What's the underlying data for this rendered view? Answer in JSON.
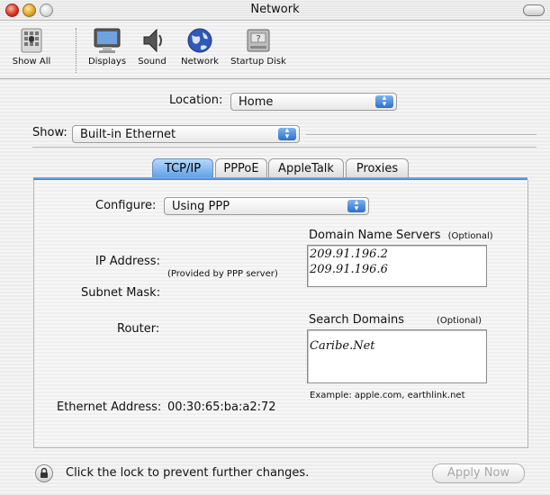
{
  "window": {
    "title": "Network"
  },
  "toolbar": {
    "items": [
      {
        "label": "Show All",
        "icon": "show-all-icon"
      },
      {
        "label": "Displays",
        "icon": "displays-icon"
      },
      {
        "label": "Sound",
        "icon": "sound-icon"
      },
      {
        "label": "Network",
        "icon": "network-icon"
      },
      {
        "label": "Startup Disk",
        "icon": "startup-disk-icon"
      }
    ]
  },
  "location": {
    "label": "Location:",
    "value": "Home"
  },
  "show": {
    "label": "Show:",
    "value": "Built-in Ethernet"
  },
  "tabs": [
    "TCP/IP",
    "PPPoE",
    "AppleTalk",
    "Proxies"
  ],
  "tcpip": {
    "configure_label": "Configure:",
    "configure_value": "Using PPP",
    "ip_address_label": "IP Address:",
    "provided_note": "(Provided by PPP server)",
    "subnet_mask_label": "Subnet Mask:",
    "router_label": "Router:",
    "dns_label": "Domain Name Servers",
    "dns_optional": "(Optional)",
    "dns_servers": [
      "209.91.196.2",
      "209.91.196.6"
    ],
    "search_label": "Search Domains",
    "search_optional": "(Optional)",
    "search_domains": [
      "Caribe.Net"
    ],
    "example_text": "Example: apple.com, earthlink.net",
    "ethernet_label": "Ethernet Address:",
    "ethernet_value": "00:30:65:ba:a2:72"
  },
  "footer": {
    "lock_text": "Click the lock to prevent further changes.",
    "apply_label": "Apply Now"
  },
  "colors": {
    "tab_active": "#5e9ee6",
    "popup_arrows": "#2b6fd0"
  }
}
